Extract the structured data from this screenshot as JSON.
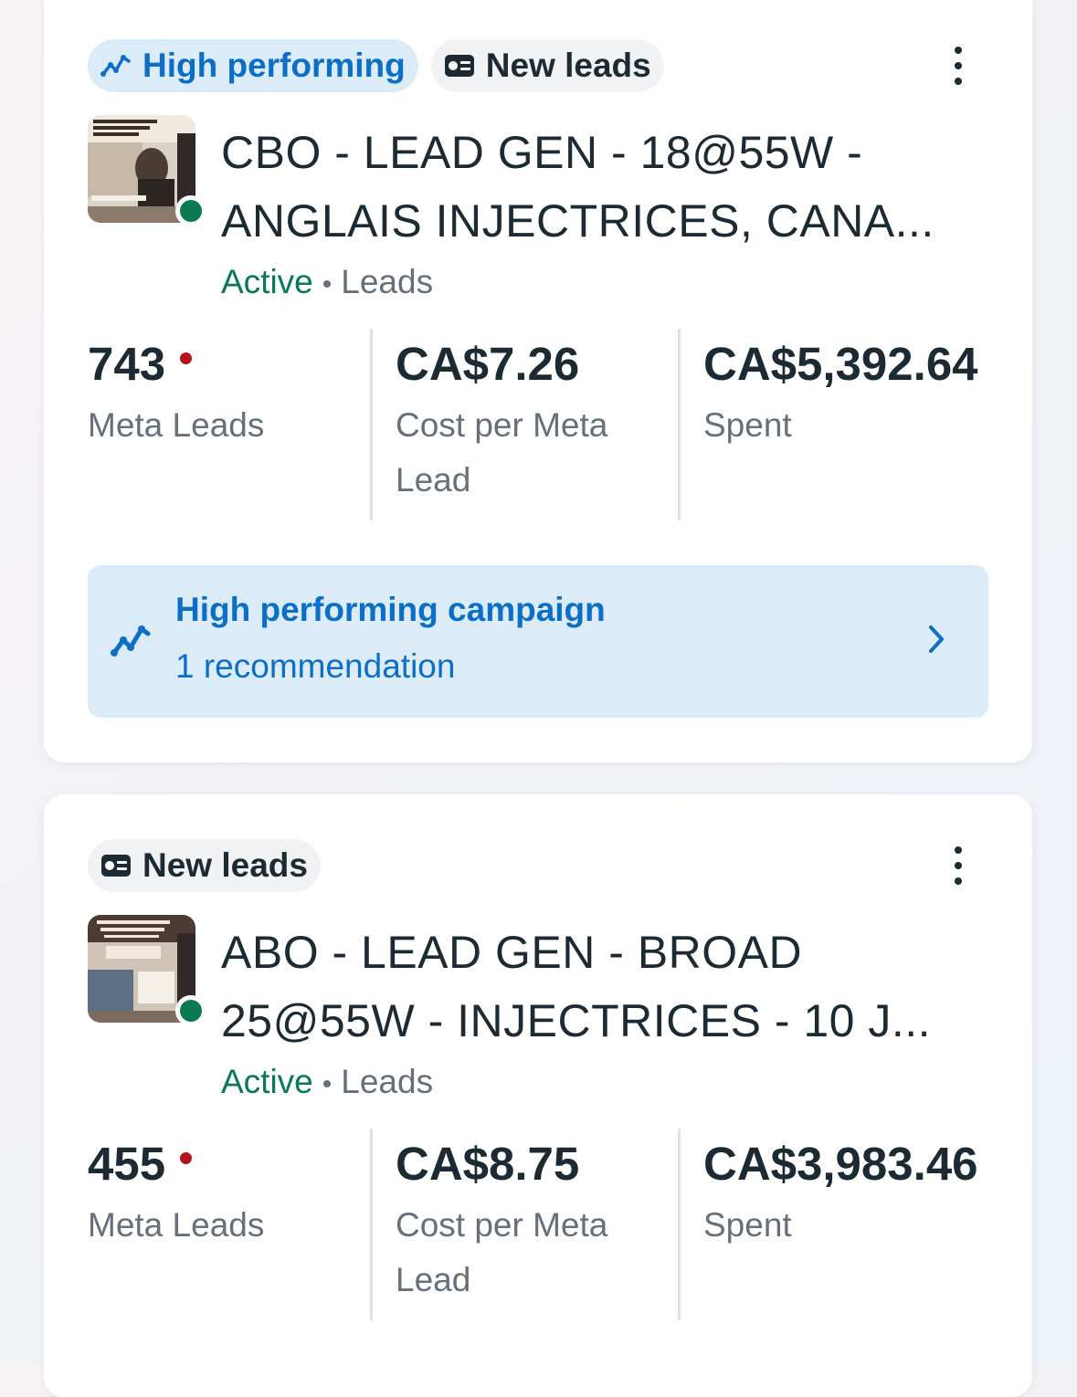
{
  "campaigns": [
    {
      "badges": [
        {
          "label": "High performing",
          "icon": "trend-line-icon"
        },
        {
          "label": "New leads",
          "icon": "lead-card-icon"
        }
      ],
      "title_line1": "CBO - LEAD GEN - 18@55W -",
      "title_line2": "ANGLAIS INJECTRICES, CANA...",
      "status": "Active",
      "objective": "Leads",
      "metrics": {
        "leads_value": "743",
        "leads_label": "Meta Leads",
        "cpl_value": "CA$7.26",
        "cpl_label": "Cost per Meta Lead",
        "spent_value": "CA$5,392.64",
        "spent_label": "Spent"
      },
      "recommendation": {
        "title": "High performing campaign",
        "subtitle": "1 recommendation"
      }
    },
    {
      "badges": [
        {
          "label": "New leads",
          "icon": "lead-card-icon"
        }
      ],
      "title_line1": "ABO - LEAD GEN - BROAD",
      "title_line2": "25@55W - INJECTRICES - 10 J...",
      "status": "Active",
      "objective": "Leads",
      "metrics": {
        "leads_value": "455",
        "leads_label": "Meta Leads",
        "cpl_value": "CA$8.75",
        "cpl_label": "Cost per Meta Lead",
        "spent_value": "CA$3,983.46",
        "spent_label": "Spent"
      }
    }
  ],
  "colors": {
    "accent_blue": "#0b6ec7",
    "badge_blue_bg": "#dcebf8",
    "active_green": "#0a7a52",
    "alert_red": "#b3141c",
    "text_dark": "#1c2b33",
    "text_muted": "#65707a"
  }
}
